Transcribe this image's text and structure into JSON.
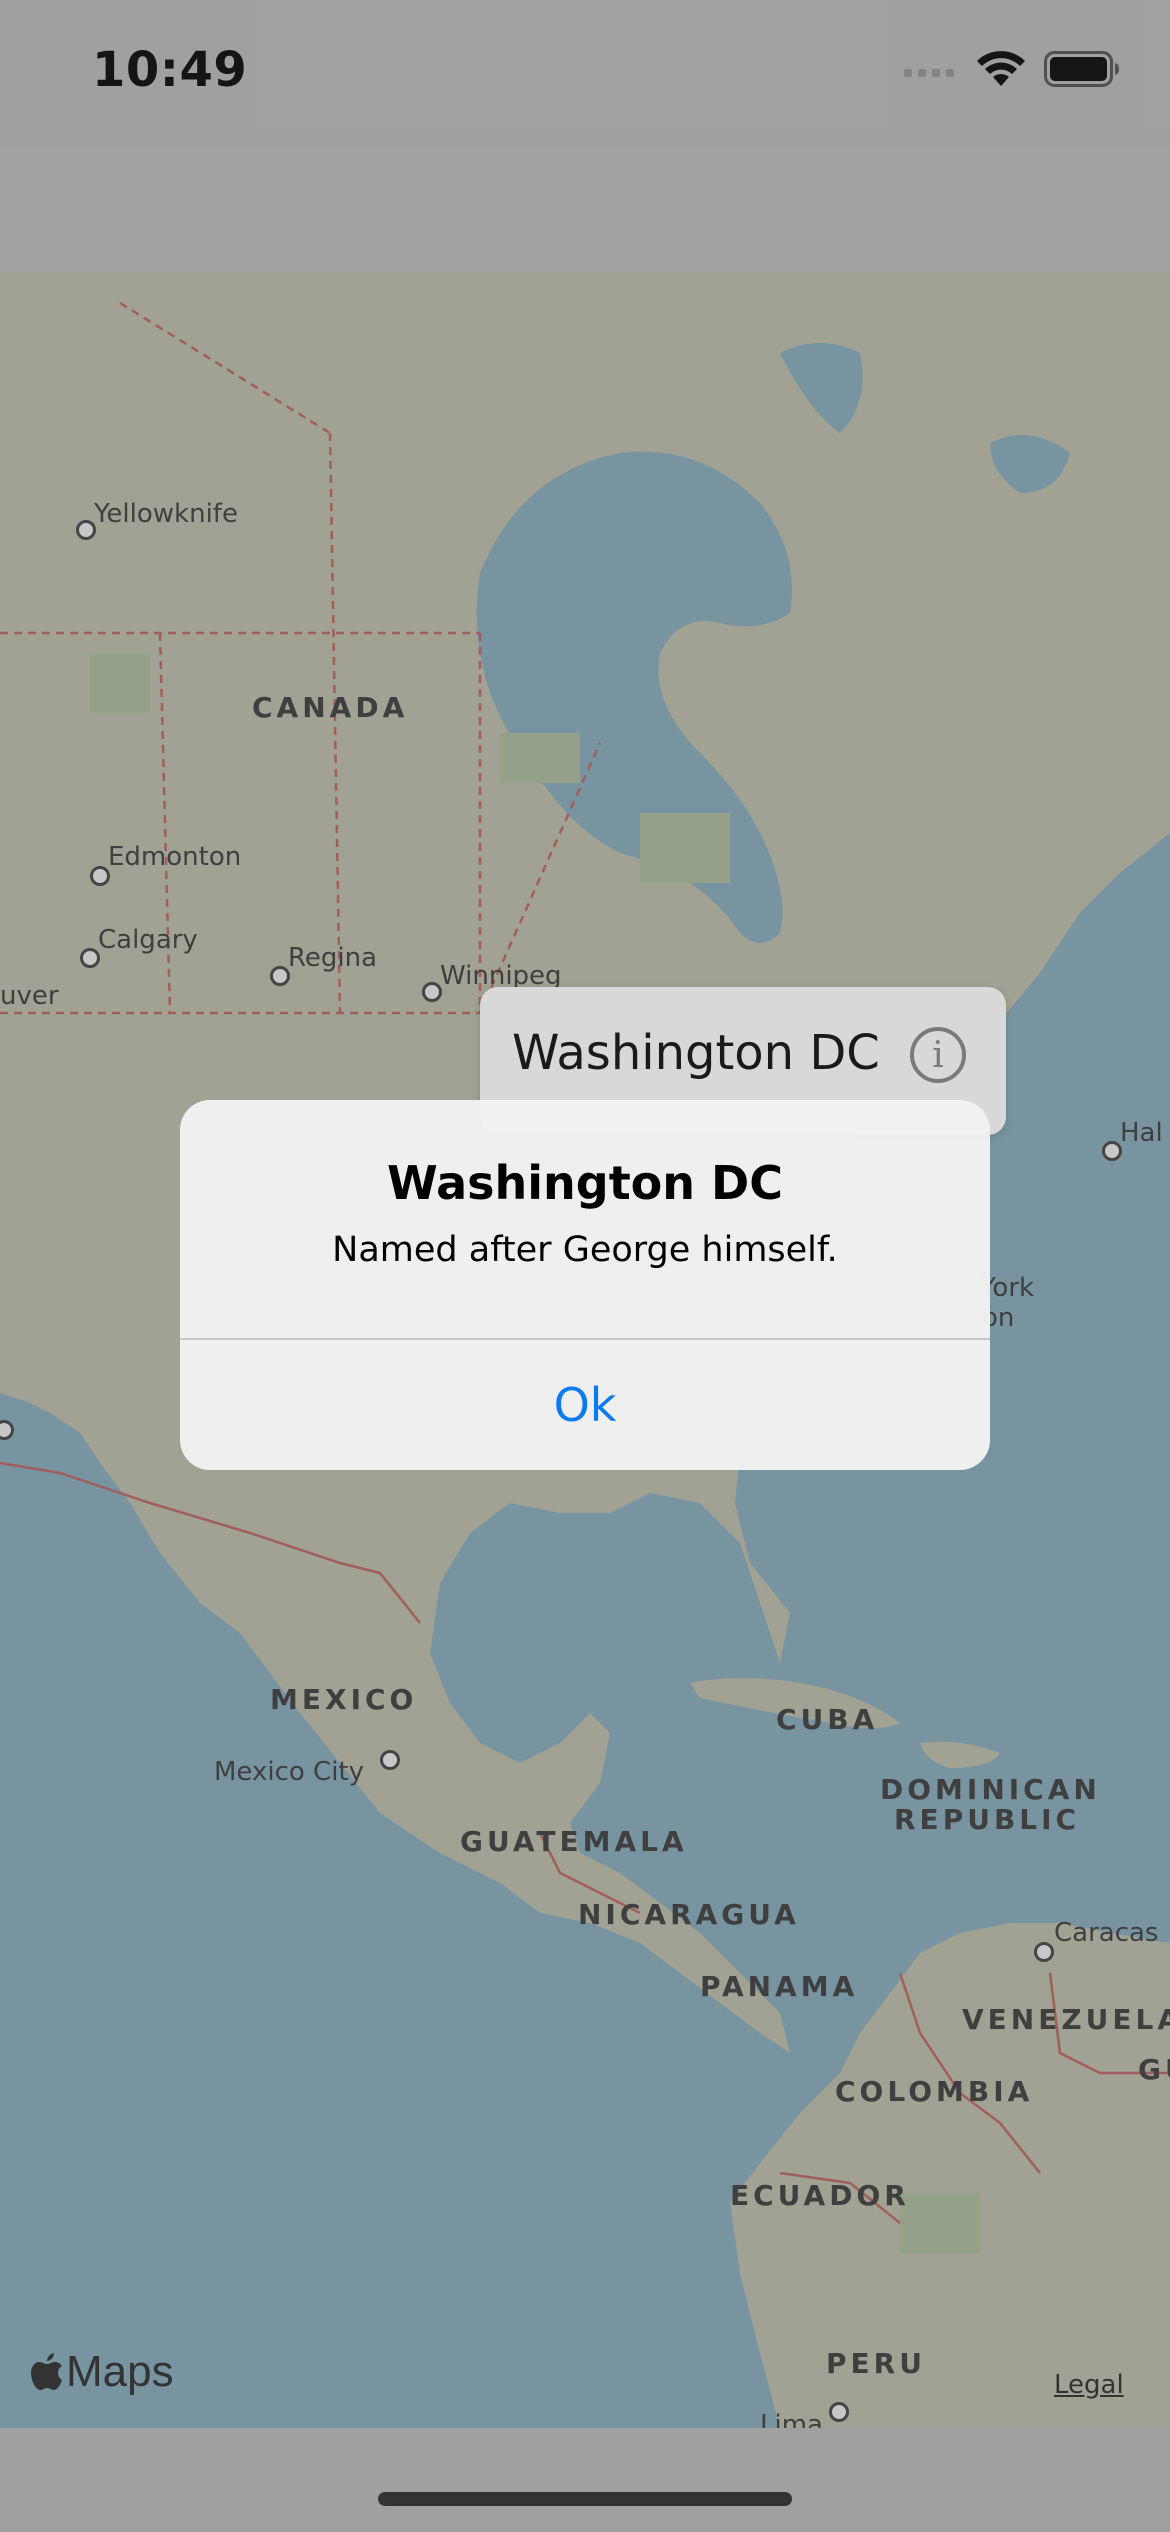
{
  "status_bar": {
    "time": "10:49"
  },
  "map": {
    "countries": [
      {
        "key": "canada",
        "name": "CANADA"
      },
      {
        "key": "mexico",
        "name": "MEXICO"
      },
      {
        "key": "cuba",
        "name": "CUBA"
      },
      {
        "key": "dominican1",
        "name": "DOMINICAN"
      },
      {
        "key": "dominican2",
        "name": "REPUBLIC"
      },
      {
        "key": "guatemala",
        "name": "GUATEMALA"
      },
      {
        "key": "nicaragua",
        "name": "NICARAGUA"
      },
      {
        "key": "panama",
        "name": "PANAMA"
      },
      {
        "key": "venezuela",
        "name": "VENEZUELA"
      },
      {
        "key": "colombia",
        "name": "COLOMBIA"
      },
      {
        "key": "ecuador",
        "name": "ECUADOR"
      },
      {
        "key": "peru",
        "name": "PERU"
      },
      {
        "key": "gu",
        "name": "GU"
      }
    ],
    "cities": [
      {
        "key": "yellowknife",
        "name": "Yellowknife"
      },
      {
        "key": "edmonton",
        "name": "Edmonton"
      },
      {
        "key": "calgary",
        "name": "Calgary"
      },
      {
        "key": "regina",
        "name": "Regina"
      },
      {
        "key": "winnipeg",
        "name": "Winnipeg"
      },
      {
        "key": "vancouver",
        "name": "uver"
      },
      {
        "key": "halifax",
        "name": "Hal"
      },
      {
        "key": "newyork",
        "name": "York"
      },
      {
        "key": "washington",
        "name": "on"
      },
      {
        "key": "mexicocity",
        "name": "Mexico City"
      },
      {
        "key": "caracas",
        "name": "Caracas"
      },
      {
        "key": "lima",
        "name": "Lima"
      }
    ],
    "attribution_logo": "Maps",
    "legal_link": "Legal"
  },
  "callout": {
    "title": "Washington DC",
    "info_icon": "info-icon"
  },
  "alert": {
    "title": "Washington DC",
    "message": "Named after George himself.",
    "ok_label": "Ok"
  },
  "colors": {
    "water": "#8eb6c9",
    "land": "#c8c8b8",
    "accent": "#0a7af0",
    "border": "#c45a5a"
  }
}
